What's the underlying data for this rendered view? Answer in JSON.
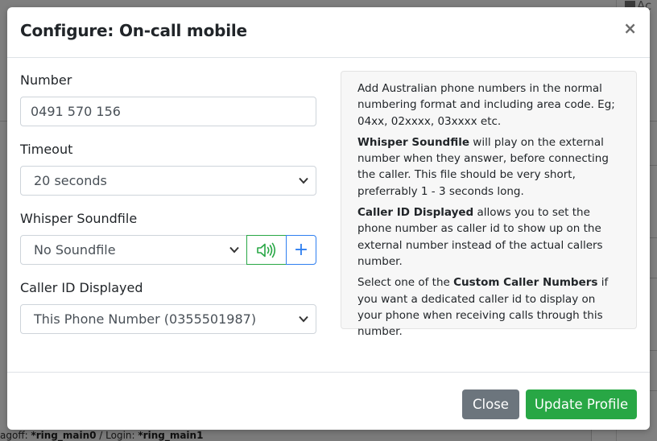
{
  "modal": {
    "title": "Configure: On-call mobile",
    "close_glyph": "×"
  },
  "form": {
    "number_label": "Number",
    "number_value": "0491 570 156",
    "timeout_label": "Timeout",
    "timeout_value": "20 seconds",
    "whisper_label": "Whisper Soundfile",
    "whisper_value": "No Soundfile",
    "plus_glyph": "+",
    "callerid_label": "Caller ID Displayed",
    "callerid_value": "This Phone Number (0355501987)"
  },
  "help": {
    "p1": "Add Australian phone numbers in the normal numbering format and including area code. Eg; 04xx, 02xxxx, 03xxxx etc.",
    "p2_bold": "Whisper Soundfile",
    "p2_rest": " will play on the external number when they answer, before connecting the caller. This file should be very short, preferrably 1 - 3 seconds long.",
    "p3_bold": "Caller ID Displayed",
    "p3_rest": " allows you to set the phone number as caller id to show up on the external number instead of the actual callers number.",
    "p4_a": "Select one of the ",
    "p4_bold": "Custom Caller Numbers",
    "p4_rest": " if you want a dedicated caller id to display on your phone when receiving calls through this number."
  },
  "footer": {
    "close_label": "Close",
    "update_label": "Update Profile"
  },
  "background": {
    "top_right": "Ac",
    "bottom_a": "agoff: ",
    "bottom_b": "*ring_main0",
    "bottom_c": " / Login: ",
    "bottom_d": "*ring_main1"
  },
  "colors": {
    "primary": "#2f7ff0",
    "success": "#28a745",
    "secondary": "#6c757d"
  },
  "icons": {
    "sound": "volume-icon",
    "add": "plus-icon",
    "close": "close-icon"
  }
}
